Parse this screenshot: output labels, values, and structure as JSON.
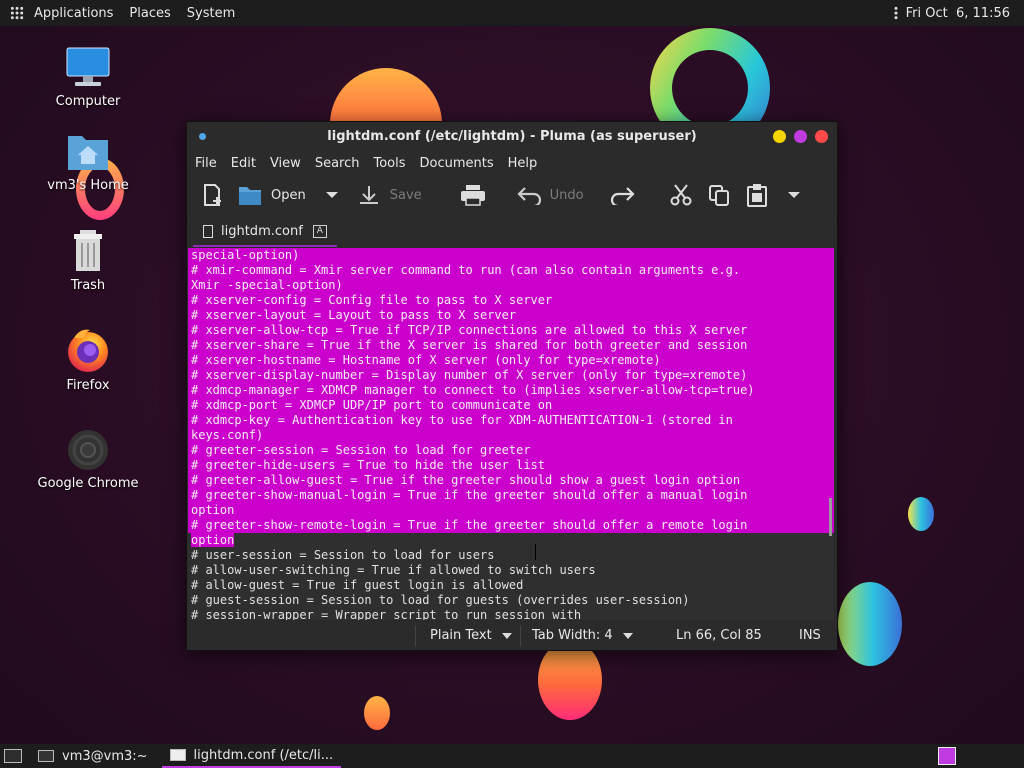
{
  "top_panel": {
    "menus": [
      "Applications",
      "Places",
      "System"
    ],
    "clock": "Fri Oct  6, 11:56"
  },
  "desktop_icons": [
    {
      "label": "Computer",
      "icon": "computer-icon"
    },
    {
      "label": "vm3's Home",
      "icon": "home-folder-icon"
    },
    {
      "label": "Trash",
      "icon": "trash-icon"
    },
    {
      "label": "Firefox",
      "icon": "firefox-icon"
    },
    {
      "label": "Google Chrome",
      "icon": "chrome-icon"
    }
  ],
  "window": {
    "title": "lightdm.conf (/etc/lightdm) - Pluma (as superuser)",
    "menus": [
      "File",
      "Edit",
      "View",
      "Search",
      "Tools",
      "Documents",
      "Help"
    ],
    "toolbar": {
      "open_label": "Open",
      "save_label": "Save",
      "undo_label": "Undo"
    },
    "tab_label": "lightdm.conf",
    "editor_lines": [
      {
        "text": "special-option)",
        "selected": "full"
      },
      {
        "text": "# xmir-command = Xmir server command to run (can also contain arguments e.g.",
        "selected": "full"
      },
      {
        "text": "Xmir -special-option)",
        "selected": "full"
      },
      {
        "text": "# xserver-config = Config file to pass to X server",
        "selected": "full"
      },
      {
        "text": "# xserver-layout = Layout to pass to X server",
        "selected": "full"
      },
      {
        "text": "# xserver-allow-tcp = True if TCP/IP connections are allowed to this X server",
        "selected": "full"
      },
      {
        "text": "# xserver-share = True if the X server is shared for both greeter and session",
        "selected": "full"
      },
      {
        "text": "# xserver-hostname = Hostname of X server (only for type=xremote)",
        "selected": "full"
      },
      {
        "text": "# xserver-display-number = Display number of X server (only for type=xremote)",
        "selected": "full"
      },
      {
        "text": "# xdmcp-manager = XDMCP manager to connect to (implies xserver-allow-tcp=true)",
        "selected": "full"
      },
      {
        "text": "# xdmcp-port = XDMCP UDP/IP port to communicate on",
        "selected": "full"
      },
      {
        "text": "# xdmcp-key = Authentication key to use for XDM-AUTHENTICATION-1 (stored in",
        "selected": "full"
      },
      {
        "text": "keys.conf)",
        "selected": "full"
      },
      {
        "text": "# greeter-session = Session to load for greeter",
        "selected": "full"
      },
      {
        "text": "# greeter-hide-users = True to hide the user list",
        "selected": "full"
      },
      {
        "text": "# greeter-allow-guest = True if the greeter should show a guest login option",
        "selected": "full"
      },
      {
        "text": "# greeter-show-manual-login = True if the greeter should offer a manual login",
        "selected": "full"
      },
      {
        "text": "option",
        "selected": "full"
      },
      {
        "text": "# greeter-show-remote-login = True if the greeter should offer a remote login",
        "selected": "full"
      },
      {
        "text": "option",
        "selected": "partial"
      },
      {
        "text": "# user-session = Session to load for users",
        "selected": "none"
      },
      {
        "text": "# allow-user-switching = True if allowed to switch users",
        "selected": "none"
      },
      {
        "text": "# allow-guest = True if guest login is allowed",
        "selected": "none"
      },
      {
        "text": "# guest-session = Session to load for guests (overrides user-session)",
        "selected": "none"
      },
      {
        "text": "# session-wrapper = Wrapper script to run session with",
        "selected": "none"
      }
    ],
    "status": {
      "language": "Plain Text",
      "tab_width": "Tab Width: 4",
      "position": "Ln 66, Col 85",
      "mode": "INS"
    }
  },
  "bottom_panel": {
    "tasks": [
      "vm3@vm3:~",
      "lightdm.conf (/etc/li..."
    ]
  },
  "colors": {
    "selection": "#cc00cc",
    "accent": "#c13ce0"
  }
}
